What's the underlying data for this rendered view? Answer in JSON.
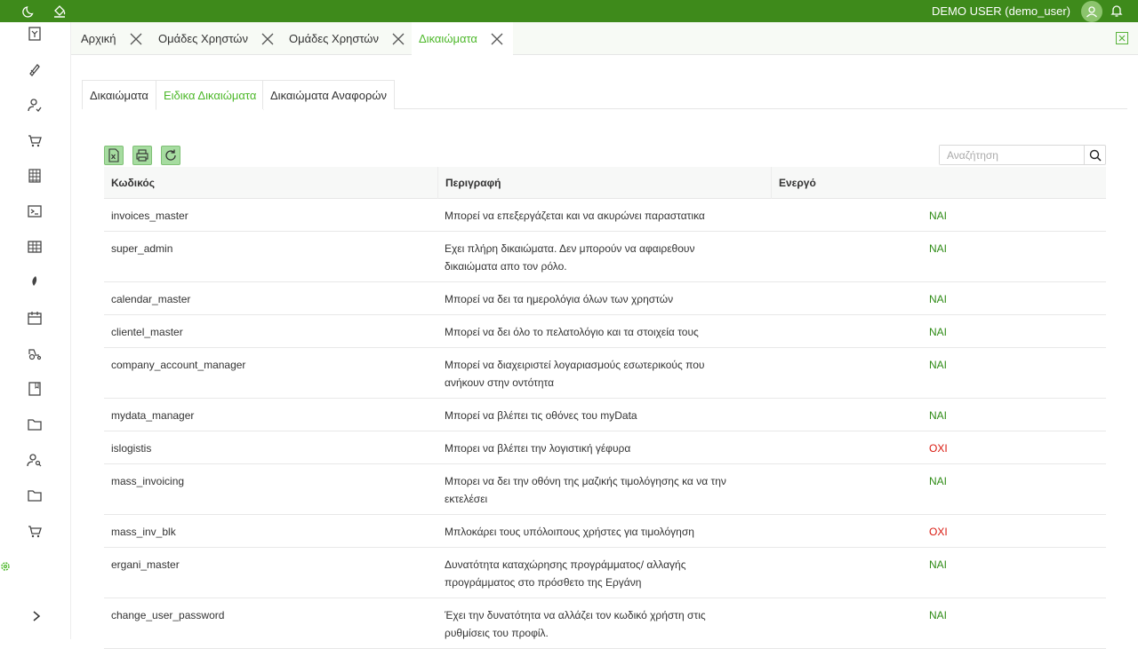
{
  "topbar": {
    "user_label": "DEMO USER (demo_user)",
    "icons": [
      "moon-icon",
      "paint-bucket-icon",
      "avatar-icon",
      "bell-icon"
    ]
  },
  "sidebar": {
    "icons": [
      "invoice-icon",
      "pen-icon",
      "user-check-icon",
      "cart-icon",
      "grid-building-icon",
      "terminal-icon",
      "table-icon",
      "leaf-icon",
      "calendar-icon",
      "tractor-icon",
      "book-icon",
      "folder-icon",
      "user-search-icon",
      "folder-icon-2",
      "cart-icon-2",
      "settings-icon",
      "expand-chevron-icon"
    ]
  },
  "tabs": [
    {
      "label": "Αρχική",
      "active": false
    },
    {
      "label": "Ομάδες Χρηστών",
      "active": false
    },
    {
      "label": "Ομάδες Χρηστών",
      "active": false
    },
    {
      "label": "Δικαιώματα",
      "active": true
    }
  ],
  "subtabs": [
    {
      "label": "Δικαιώματα",
      "active": false
    },
    {
      "label": "Ειδικα Δικαιώματα",
      "active": true
    },
    {
      "label": "Δικαιώματα Αναφορών",
      "active": false
    }
  ],
  "search": {
    "placeholder": "Αναζήτηση"
  },
  "table": {
    "headers": {
      "code": "Κωδικός",
      "description": "Περιγραφή",
      "active": "Ενεργό"
    },
    "rows": [
      {
        "code": "invoices_master",
        "desc1": "Μπορεί να επεξεργάζεται και να ακυρώνει παραστατικα",
        "desc2": "",
        "active": "ΝΑΙ",
        "is_yes": true
      },
      {
        "code": "super_admin",
        "desc1": "Εχει πλήρη δικαιώματα. Δεν μπορούν να αφαιρεθουν",
        "desc2": "δικαιώματα απο τον ρόλο.",
        "active": "ΝΑΙ",
        "is_yes": true
      },
      {
        "code": "calendar_master",
        "desc1": "Μπορεί να δει τα ημερολόγια όλων των χρηστών",
        "desc2": "",
        "active": "ΝΑΙ",
        "is_yes": true
      },
      {
        "code": "clientel_master",
        "desc1": "Μπορεί να δει όλο το πελατολόγιο και τα στοιχεία τους",
        "desc2": "",
        "active": "ΝΑΙ",
        "is_yes": true
      },
      {
        "code": "company_account_manager",
        "desc1": "Μπορεί να διαχειριστεί λογαριασμούς εσωτερικούς που",
        "desc2": "ανήκουν στην οντότητα",
        "active": "ΝΑΙ",
        "is_yes": true
      },
      {
        "code": "mydata_manager",
        "desc1": "Μπορεί να βλέπει τις οθόνες του myData",
        "desc2": "",
        "active": "ΝΑΙ",
        "is_yes": true
      },
      {
        "code": "islogistis",
        "desc1": "Μπορει να βλέπει την λογιστική γέφυρα",
        "desc2": "",
        "active": "ΟΧΙ",
        "is_yes": false
      },
      {
        "code": "mass_invoicing",
        "desc1": "Μπορει να δει την οθόνη της μαζικής τιμολόγησης κα να την",
        "desc2": "εκτελέσει",
        "active": "ΝΑΙ",
        "is_yes": true
      },
      {
        "code": "mass_inv_blk",
        "desc1": "Μπλοκάρει τους υπόλοιπους χρήστες για τιμολόγηση",
        "desc2": "",
        "active": "ΟΧΙ",
        "is_yes": false
      },
      {
        "code": "ergani_master",
        "desc1": "Δυνατότητα καταχώρησης προγράμματος/ αλλαγής",
        "desc2": "προγράμματος στο πρόσθετο της Εργάνη",
        "active": "ΝΑΙ",
        "is_yes": true
      },
      {
        "code": "change_user_password",
        "desc1": "Έχει την δυνατότητα να αλλάζει τον κωδικό χρήστη στις",
        "desc2": "ρυθμίσεις του προφίλ.",
        "active": "ΝΑΙ",
        "is_yes": true
      }
    ]
  }
}
